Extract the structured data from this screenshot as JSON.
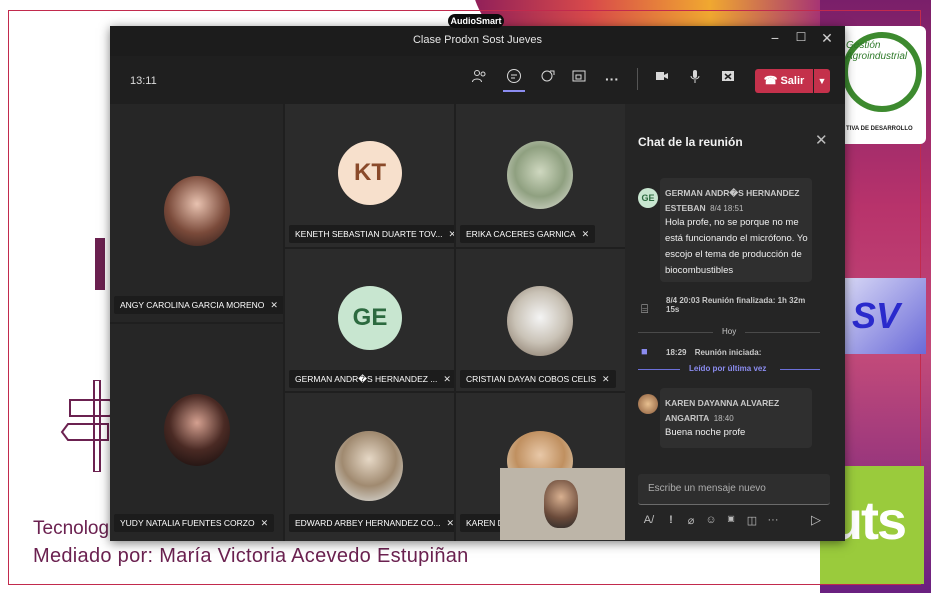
{
  "slide": {
    "line1": "Tecnolog",
    "line2": "Mediado por: María Victoria Acevedo Estupiñan",
    "logo_text": "Gestión Agroindustrial",
    "logo_footer": "TIVA DE DESARROLLO",
    "sv_text": "SV",
    "uts_text": "uts"
  },
  "window": {
    "title": "Clase Prodxn Sost Jueves",
    "app_badge": "AudioSmart",
    "minimize": "−",
    "maximize": "☐",
    "close": "✕"
  },
  "toolbar": {
    "time": "13:11",
    "leave_label": "Salir"
  },
  "participants": [
    {
      "name": "ANGY CAROLINA GARCIA MORENO"
    },
    {
      "name": "KENETH SEBASTIAN DUARTE TOV...",
      "initials": "KT"
    },
    {
      "name": "ERIKA CACERES GARNICA"
    },
    {
      "name": "GERMAN ANDR�S HERNANDEZ ...",
      "initials": "GE"
    },
    {
      "name": "CRISTIAN DAYAN COBOS CELIS"
    },
    {
      "name": "YUDY NATALIA FUENTES CORZO"
    },
    {
      "name": "EDWARD ARBEY HERNANDEZ CO..."
    },
    {
      "name": "KAREN DA"
    }
  ],
  "chat": {
    "title": "Chat de la reunión",
    "messages": [
      {
        "author": "GERMAN ANDR�S HERNANDEZ ESTEBAN",
        "time": "8/4 18:51",
        "avatar": "GE",
        "text": "Hola profe, no se porque no me está funcionando el micrófono. Yo escojo el tema de producción de biocombustibles"
      },
      {
        "author": "KAREN DAYANNA ALVAREZ ANGARITA",
        "time": "18:40",
        "text": "Buena noche profe"
      }
    ],
    "meeting_end_time": "8/4 20:03",
    "meeting_end_text": "Reunión finalizada: 1h 32m 15s",
    "divider_today": "Hoy",
    "meeting_start_time": "18:29",
    "meeting_start_text": "Reunión iniciada:",
    "last_read": "Leído por última vez",
    "compose_placeholder": "Escribe un mensaje nuevo"
  },
  "colors": {
    "leave": "#c4314b",
    "accent": "#8b8cf0",
    "slide_text": "#6b2150"
  }
}
